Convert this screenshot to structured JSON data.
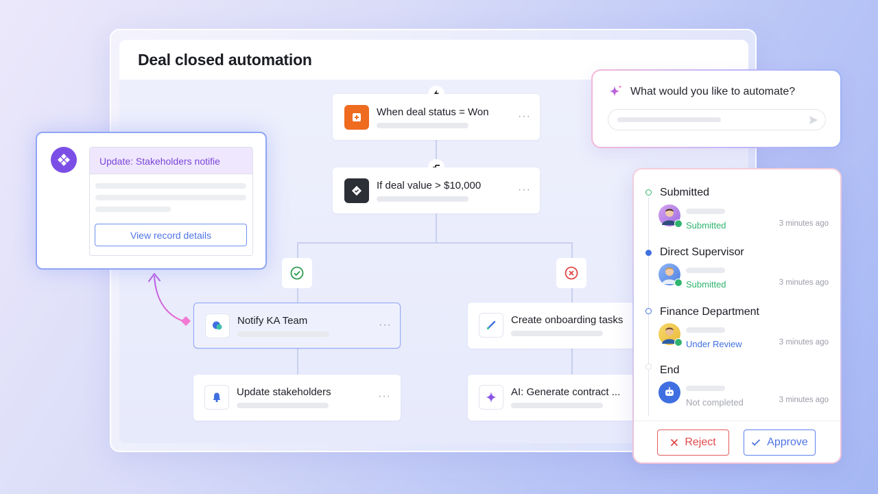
{
  "window": {
    "title": "Deal closed automation"
  },
  "flow": {
    "trigger": {
      "title": "When deal status = Won"
    },
    "condition": {
      "title": "If deal value > $10,000"
    },
    "yes_branch": {
      "node1": {
        "title": "Notify KA Team"
      },
      "node2": {
        "title": "Update stakeholders"
      }
    },
    "no_branch": {
      "node1": {
        "title": "Create onboarding tasks"
      },
      "node2": {
        "title": "AI: Generate contract ..."
      }
    },
    "more_label": "···"
  },
  "record_card": {
    "header": "Update: Stakeholders notifie",
    "button": "View record details"
  },
  "prompt": {
    "question": "What would you like to automate?"
  },
  "approval": {
    "steps": [
      {
        "title": "Submitted",
        "status": "Submitted",
        "time": "3 minutes ago"
      },
      {
        "title": "Direct Supervisor",
        "status": "Submitted",
        "time": "3 minutes ago"
      },
      {
        "title": "Finance Department",
        "status": "Under Review",
        "time": "3 minutes ago"
      },
      {
        "title": "End",
        "status": "Not completed",
        "time": "3 minutes ago"
      }
    ],
    "reject_label": "Reject",
    "approve_label": "Approve"
  },
  "colors": {
    "accent": "#4f72e2",
    "success": "#2fb36e",
    "danger": "#e24848",
    "purple": "#7b4fe6",
    "orange": "#ee6b1f"
  },
  "icons": [
    "lightning-icon",
    "split-icon",
    "check-circle-icon",
    "x-circle-icon",
    "sparkle-icon",
    "send-icon",
    "bell-icon",
    "chat-icon",
    "robot-icon"
  ]
}
